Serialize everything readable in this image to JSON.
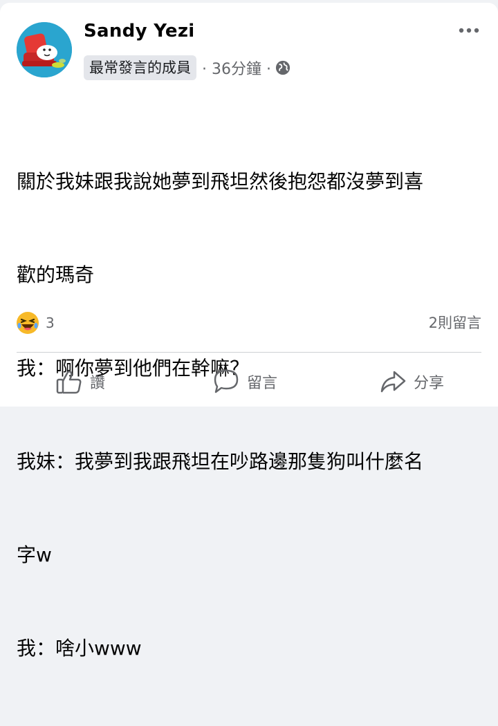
{
  "post": {
    "author": "Sandy Yezi",
    "badge": "最常發言的成員",
    "time": "· 36分鐘 ·",
    "privacy_icon": "globe-icon",
    "more_icon": "more-options-icon",
    "text_lines": [
      "關於我妹跟我說她夢到飛坦然後抱怨都沒夢到喜",
      "歡的瑪奇",
      "我：啊你夢到他們在幹嘛？",
      "我妹：我夢到我跟飛坦在吵路邊那隻狗叫什麼名",
      "字w",
      "我：啥小www"
    ]
  },
  "reactions": {
    "icon": "laughing-emoji-icon",
    "count": "3",
    "comments": "2則留言"
  },
  "actions": {
    "like": "讚",
    "comment": "留言",
    "share": "分享"
  },
  "colors": {
    "background": "#ffffff",
    "secondary_text": "#65676b",
    "badge_bg": "#e4e6eb",
    "avatar_bg": "#2aa5cf"
  }
}
